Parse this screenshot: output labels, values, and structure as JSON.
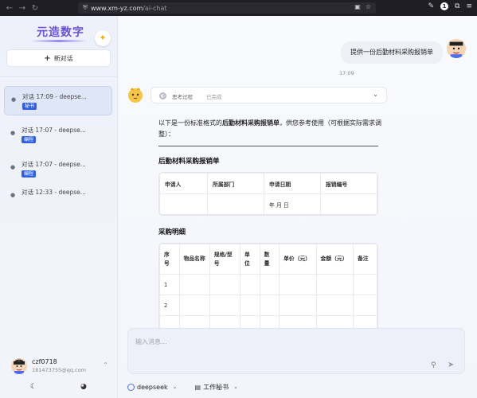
{
  "browser": {
    "url_domain": "www.xm-yz.com",
    "url_path": "/ai-chat",
    "badge_count": "1"
  },
  "sidebar": {
    "logo_text": "元造数字",
    "new_chat_label": "新对话",
    "conversations": [
      {
        "title": "对话 17:09 - deepse...",
        "tag": "秘书"
      },
      {
        "title": "对话 17:07 - deepse...",
        "tag": "编程"
      },
      {
        "title": "对话 17:07 - deepse...",
        "tag": "编程"
      },
      {
        "title": "对话 12:33 - deepse...",
        "tag": ""
      }
    ],
    "user": {
      "name": "czf0718",
      "email": "181473755@qq.com"
    }
  },
  "chat": {
    "user_message": "提供一份后勤材料采购报销单",
    "user_time": "17:09",
    "thinking": {
      "label": "思考过程",
      "status": "已完成"
    },
    "answer": {
      "intro_prefix": "以下是一份标准格式的",
      "intro_bold": "后勤材料采购报销单",
      "intro_suffix": "，供您参考使用（可根据实际需求调整）：",
      "heading1": "后勤材料采购报销单",
      "table1": {
        "headers": [
          "申请人",
          "所属部门",
          "申请日期",
          "报销编号"
        ],
        "row": [
          "",
          "",
          "年 月 日",
          ""
        ]
      },
      "heading2": "采购明细",
      "table2": {
        "headers": [
          "序号",
          "物品名称",
          "规格/型号",
          "单位",
          "数量",
          "单价（元）",
          "金额（元）",
          "备注"
        ],
        "rows": [
          [
            "1",
            "",
            "",
            "",
            "",
            "",
            "",
            ""
          ],
          [
            "2",
            "",
            "",
            "",
            "",
            "",
            "",
            ""
          ],
          [
            "",
            "",
            "",
            "",
            "",
            "",
            "",
            ""
          ]
        ]
      }
    }
  },
  "composer": {
    "placeholder": "输入消息...",
    "model": "deepseek",
    "tool": "工作秘书"
  },
  "colors": {
    "accent": "#2f5fe3",
    "logo": "#6a4fd8"
  }
}
